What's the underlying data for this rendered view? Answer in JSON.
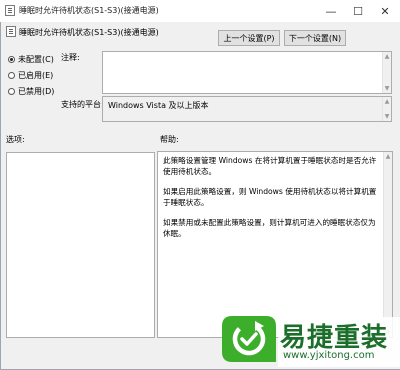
{
  "window": {
    "title": "睡眠时允许待机状态(S1-S3)(接通电源)",
    "minimize_glyph": "—",
    "maximize_glyph": "☐",
    "close_glyph": "✕"
  },
  "header": {
    "setting_title": "睡眠时允许待机状态(S1-S3)(接通电源)",
    "prev_button": "上一个设置(P)",
    "next_button": "下一个设置(N)"
  },
  "options": {
    "not_configured": "未配置(C)",
    "enabled": "已启用(E)",
    "disabled": "已禁用(D)",
    "selected": "not_configured"
  },
  "comment": {
    "label": "注释:",
    "value": ""
  },
  "supported": {
    "label": "支持的平台:",
    "value": "Windows Vista 及以上版本"
  },
  "panes": {
    "options_label": "选项:",
    "help_label": "帮助:"
  },
  "help": {
    "p1": "此策略设置管理 Windows 在将计算机置于睡眠状态时是否允许使用待机状态。",
    "p2": "如果启用此策略设置，则 Windows 使用待机状态以将计算机置于睡眠状态。",
    "p3": "如果禁用或未配置此策略设置，则计算机可进入的睡眠状态仅为休眠。"
  },
  "watermark": {
    "brand": "易捷重装",
    "url": "www.yjxitong.com",
    "colors": {
      "green": "#3dae2b",
      "text": "#1b6f2a"
    }
  }
}
